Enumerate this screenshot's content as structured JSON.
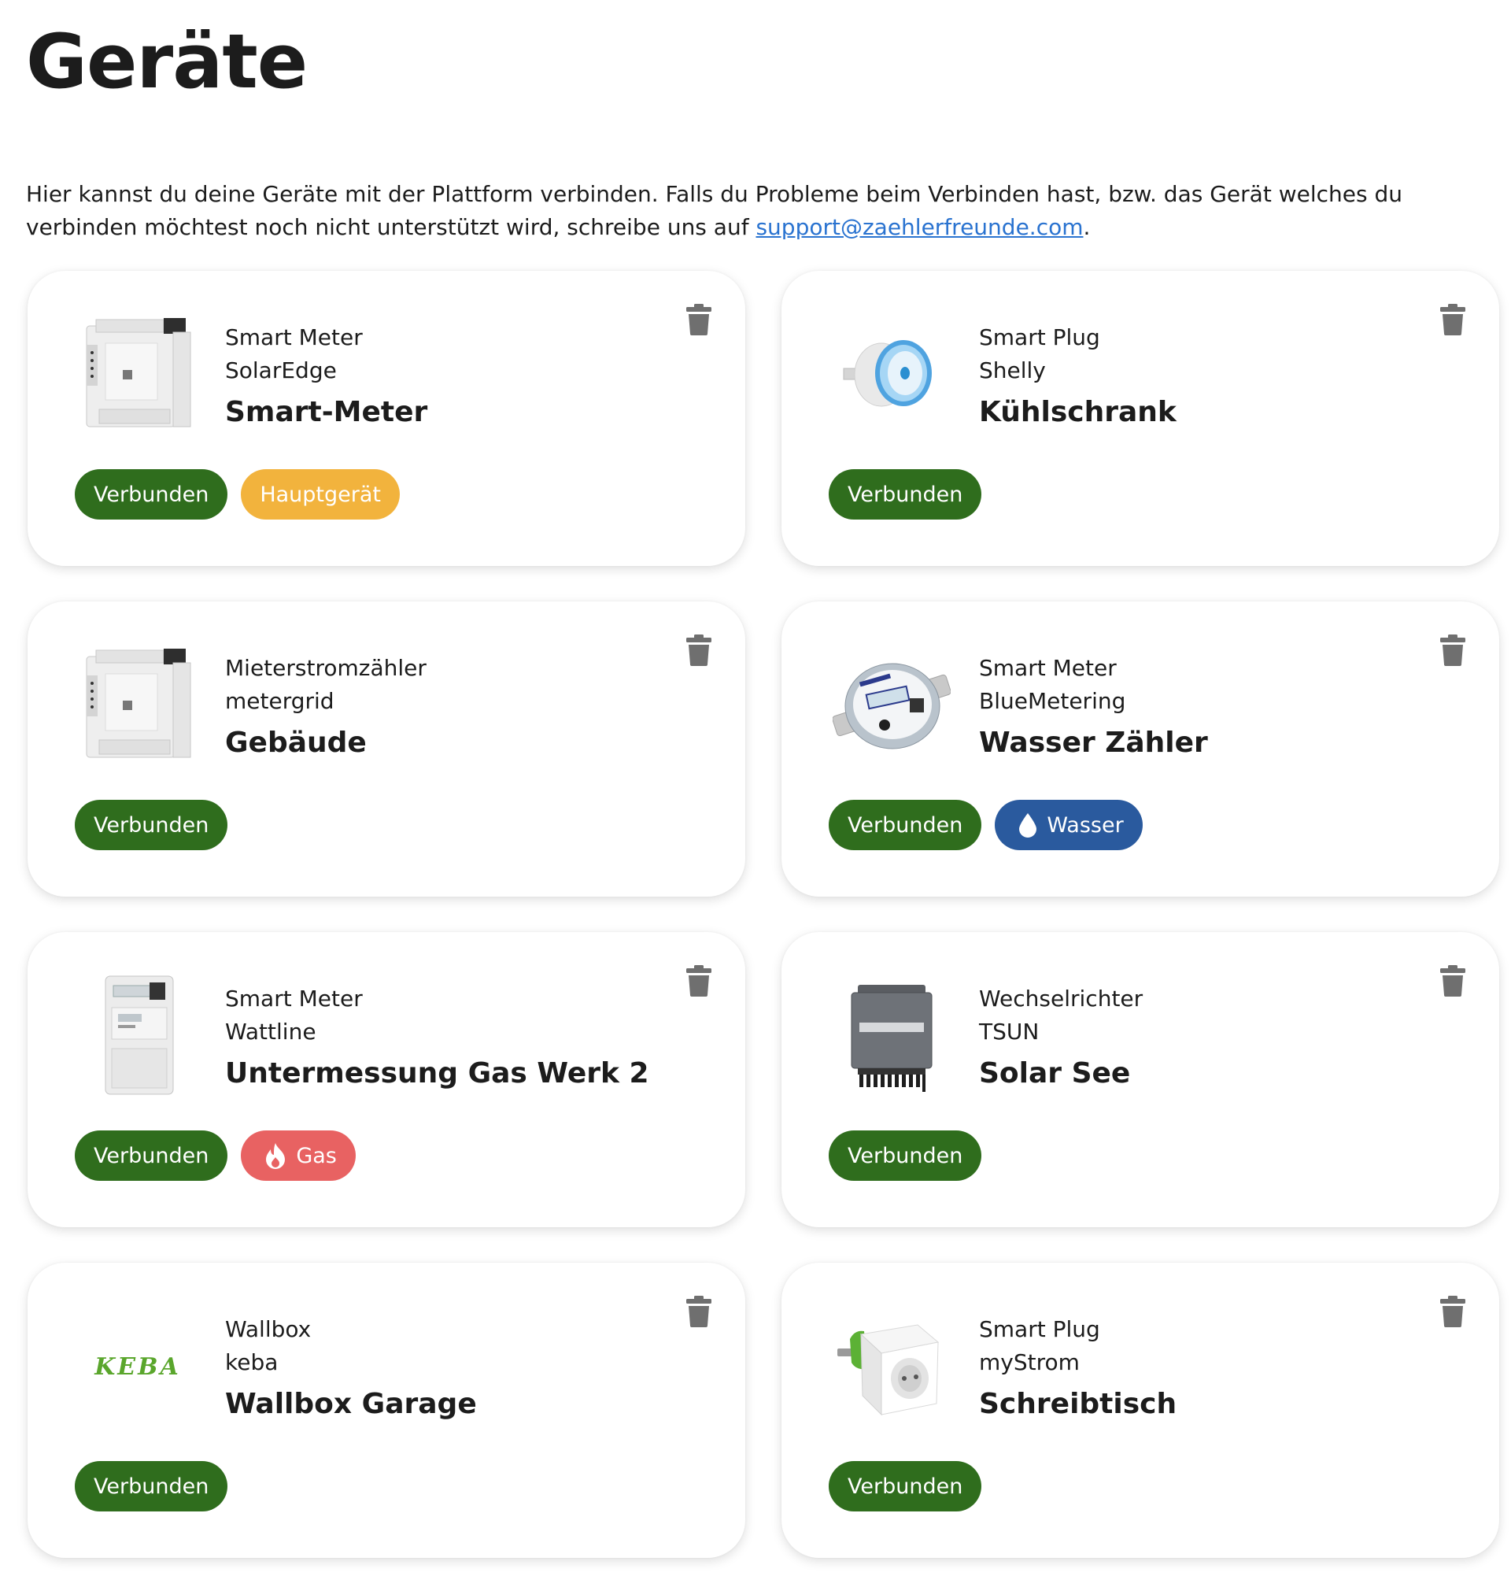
{
  "page": {
    "title": "Geräte",
    "intro_text": "Hier kannst du deine Geräte mit der Plattform verbinden. Falls du Probleme beim Verbinden hast, bzw. das Gerät welches du verbinden möchtest noch nicht unterstützt wird, schreibe uns auf ",
    "intro_link": "support@zaehlerfreunde.com",
    "intro_end": "."
  },
  "devices": [
    {
      "type": "Smart Meter",
      "vendor": "SolarEdge",
      "name": "Smart-Meter",
      "status": "Verbunden",
      "extra_badge": "Hauptgerät",
      "image": "din-rail-meter"
    },
    {
      "type": "Smart Plug",
      "vendor": "Shelly",
      "name": "Kühlschrank",
      "status": "Verbunden",
      "image": "shelly-plug"
    },
    {
      "type": "Mieterstromzähler",
      "vendor": "metergrid",
      "name": "Gebäude",
      "status": "Verbunden",
      "image": "din-rail-meter"
    },
    {
      "type": "Smart Meter",
      "vendor": "BlueMetering",
      "name": "Wasser Zähler",
      "status": "Verbunden",
      "extra_badge": "Wasser",
      "image": "water-meter"
    },
    {
      "type": "Smart Meter",
      "vendor": "Wattline",
      "name": "Untermessung Gas Werk 2",
      "status": "Verbunden",
      "extra_badge": "Gas",
      "image": "electricity-meter"
    },
    {
      "type": "Wechselrichter",
      "vendor": "TSUN",
      "name": "Solar See",
      "status": "Verbunden",
      "image": "inverter"
    },
    {
      "type": "Wallbox",
      "vendor": "keba",
      "name": "Wallbox Garage",
      "status": "Verbunden",
      "image": "keba-logo",
      "logo_text": "KEBA"
    },
    {
      "type": "Smart Plug",
      "vendor": "myStrom",
      "name": "Schreibtisch",
      "status": "Verbunden",
      "image": "mystrom-plug"
    }
  ],
  "icons": {
    "delete": "trash-icon",
    "water": "water-drop-icon",
    "gas": "flame-icon"
  },
  "colors": {
    "connected": "#2f6d1d",
    "main_device": "#f2b33d",
    "water": "#2a5a9e",
    "gas": "#e86262",
    "link": "#2a73d0",
    "trash": "#6f6f6f"
  }
}
